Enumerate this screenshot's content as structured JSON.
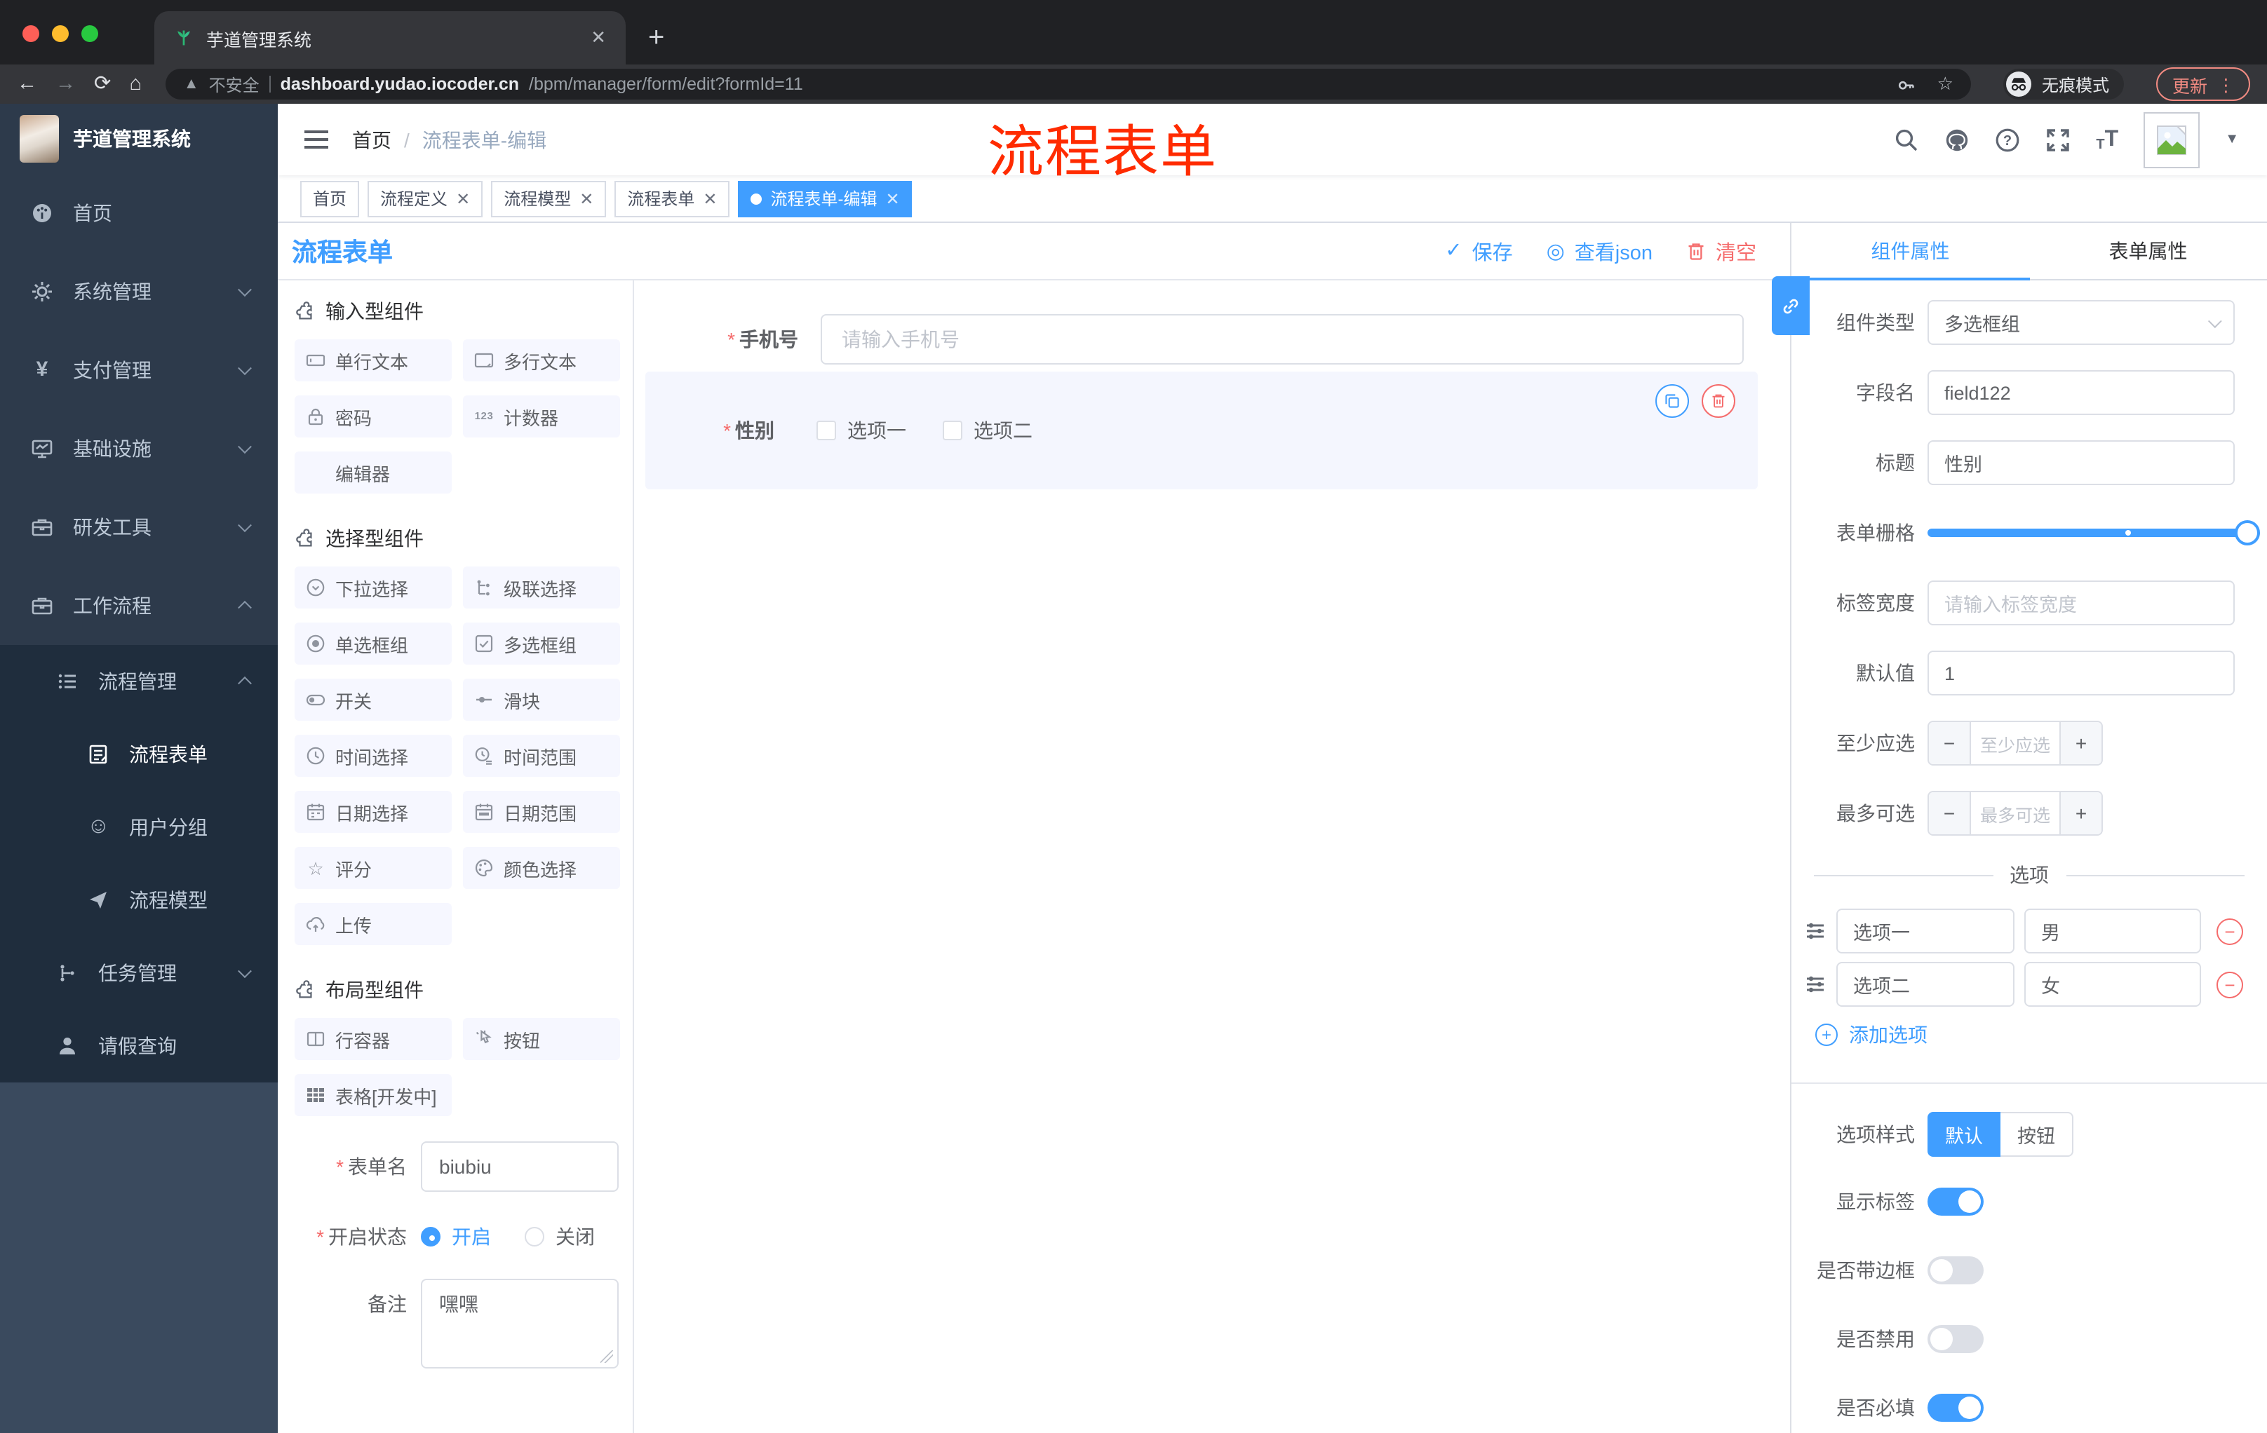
{
  "browser": {
    "tab_title": "芋道管理系统",
    "security_label": "不安全",
    "url_host": "dashboard.yudao.iocoder.cn",
    "url_path": "/bpm/manager/form/edit?formId=11",
    "incognito_label": "无痕模式",
    "update_label": "更新"
  },
  "annotation": {
    "text": "流程表单",
    "color": "#ff2b00"
  },
  "header": {
    "brand": "芋道管理系统",
    "breadcrumb": {
      "home": "首页",
      "current": "流程表单-编辑"
    }
  },
  "tags": [
    {
      "label": "首页"
    },
    {
      "label": "流程定义"
    },
    {
      "label": "流程模型"
    },
    {
      "label": "流程表单"
    },
    {
      "label": "流程表单-编辑"
    }
  ],
  "sidebar": {
    "items": [
      {
        "label": "首页"
      },
      {
        "label": "系统管理"
      },
      {
        "label": "支付管理"
      },
      {
        "label": "基础设施"
      },
      {
        "label": "研发工具"
      },
      {
        "label": "工作流程"
      },
      {
        "label": "流程管理"
      },
      {
        "label": "流程表单"
      },
      {
        "label": "用户分组"
      },
      {
        "label": "流程模型"
      },
      {
        "label": "任务管理"
      },
      {
        "label": "请假查询"
      }
    ]
  },
  "workspace": {
    "title": "流程表单",
    "toolbar": {
      "save": "保存",
      "view_json": "查看json",
      "clear": "清空"
    }
  },
  "components_panel": {
    "counter_icon": "123",
    "sections": [
      {
        "title": "输入型组件",
        "items": [
          "单行文本",
          "多行文本",
          "密码",
          "计数器",
          "编辑器"
        ]
      },
      {
        "title": "选择型组件",
        "items": [
          "下拉选择",
          "级联选择",
          "单选框组",
          "多选框组",
          "开关",
          "滑块",
          "时间选择",
          "时间范围",
          "日期选择",
          "日期范围",
          "评分",
          "颜色选择",
          "上传"
        ]
      },
      {
        "title": "布局型组件",
        "items": [
          "行容器",
          "按钮",
          "表格[开发中]"
        ]
      }
    ],
    "form": {
      "name_label": "表单名",
      "name_value": "biubiu",
      "status_label": "开启状态",
      "status_on": "开启",
      "status_off": "关闭",
      "remark_label": "备注",
      "remark_value": "嘿嘿"
    }
  },
  "canvas": {
    "phone": {
      "label": "手机号",
      "placeholder": "请输入手机号"
    },
    "gender": {
      "label": "性别",
      "options": [
        "选项一",
        "选项二"
      ]
    }
  },
  "props_panel": {
    "tabs": [
      "组件属性",
      "表单属性"
    ],
    "component_type": {
      "label": "组件类型",
      "value": "多选框组"
    },
    "field_name": {
      "label": "字段名",
      "value": "field122"
    },
    "title_row": {
      "label": "标题",
      "value": "性别"
    },
    "grid": {
      "label": "表单栅格"
    },
    "label_width": {
      "label": "标签宽度",
      "placeholder": "请输入标签宽度"
    },
    "default_value": {
      "label": "默认值",
      "value": "1"
    },
    "min_select": {
      "label": "至少应选",
      "placeholder": "至少应选"
    },
    "max_select": {
      "label": "最多可选",
      "placeholder": "最多可选"
    },
    "options_divider": "选项",
    "options": [
      {
        "name": "选项一",
        "value": "男"
      },
      {
        "name": "选项二",
        "value": "女"
      }
    ],
    "add_option": "添加选项",
    "option_style": {
      "label": "选项样式",
      "default": "默认",
      "button": "按钮"
    },
    "switches": [
      {
        "label": "显示标签"
      },
      {
        "label": "是否带边框"
      },
      {
        "label": "是否禁用"
      },
      {
        "label": "是否必填"
      }
    ],
    "accent": "#409eff",
    "danger": "#f56c6c"
  }
}
